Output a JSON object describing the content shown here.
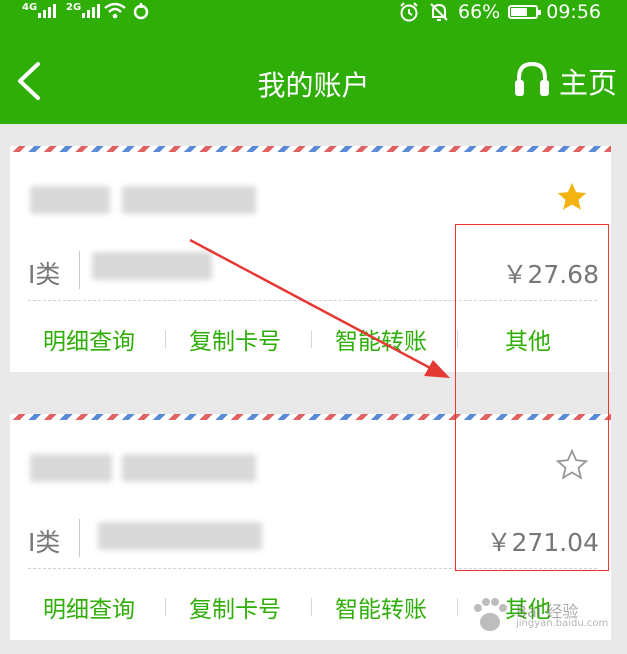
{
  "status_bar": {
    "signal1_label": "4G",
    "signal2_label": "2G",
    "battery_percent": "66%",
    "battery_level": 0.66,
    "time": "09:56"
  },
  "header": {
    "title": "我的账户",
    "home_label": "主页",
    "background": "#2fae08"
  },
  "accounts": [
    {
      "class_label": "I类",
      "amount": "￥27.68",
      "starred": true,
      "actions": [
        "明细查询",
        "复制卡号",
        "智能转账",
        "其他"
      ]
    },
    {
      "class_label": "I类",
      "amount": "￥271.04",
      "starred": false,
      "actions": [
        "明细查询",
        "复制卡号",
        "智能转账",
        "其他"
      ]
    }
  ],
  "watermark": {
    "text": "Bai 经验",
    "url": "jingyan.baidu.com"
  },
  "colors": {
    "accent": "#2fae08",
    "annotation": "#e53935",
    "star_filled": "#f2b313"
  }
}
